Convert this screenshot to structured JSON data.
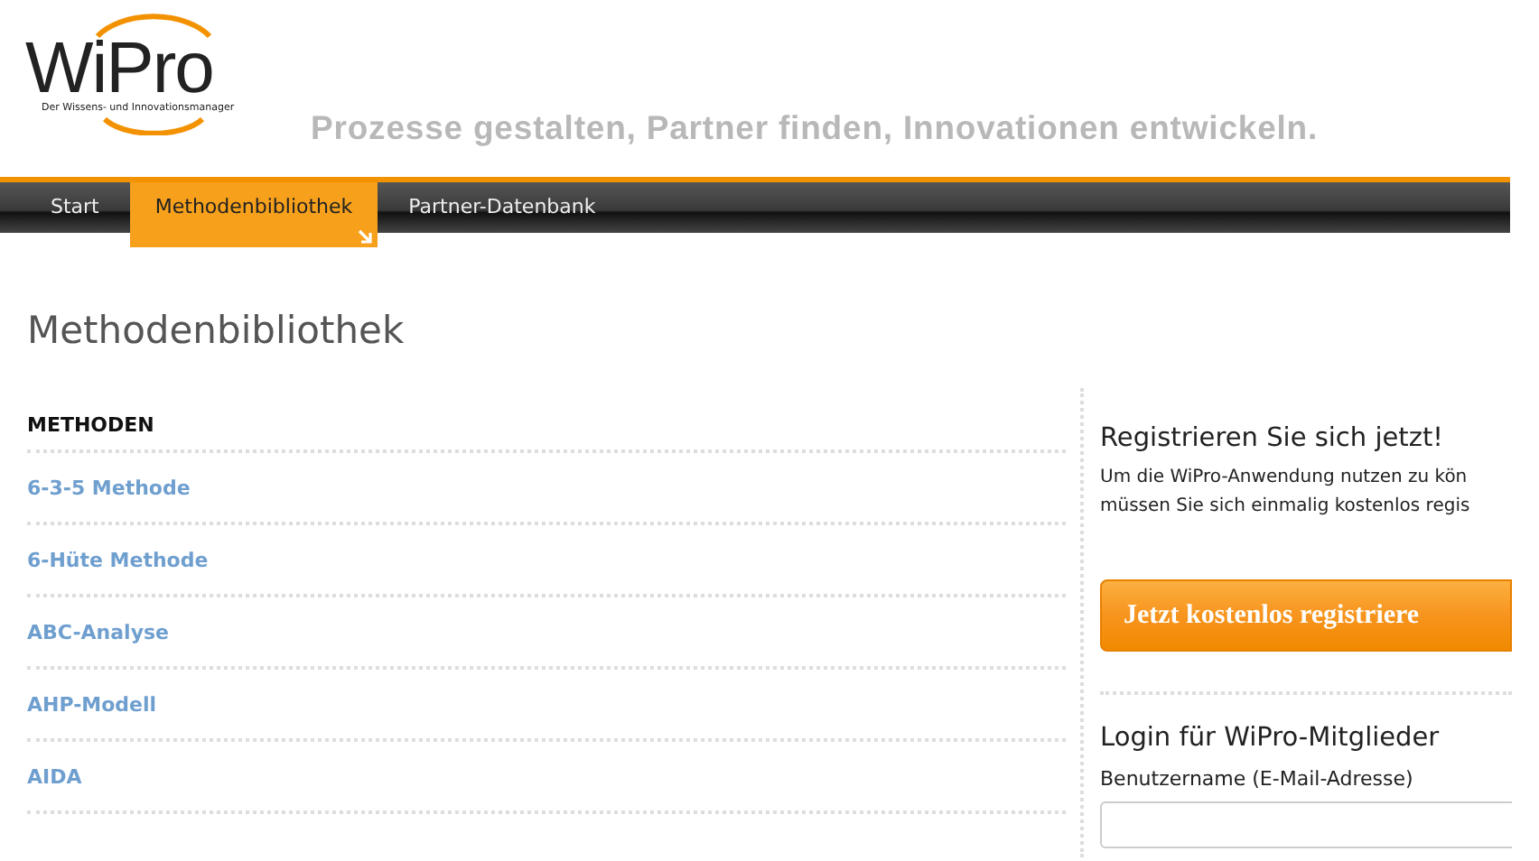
{
  "logo": {
    "name": "WiPro",
    "subtitle": "Der Wissens- und Innovationsmanager"
  },
  "tagline": "Prozesse gestalten, Partner finden, Innovationen entwickeln.",
  "nav": [
    {
      "label": "Start",
      "selected": false
    },
    {
      "label": "Methodenbibliothek",
      "selected": true
    },
    {
      "label": "Partner-Datenbank",
      "selected": false
    }
  ],
  "page_title": "Methodenbibliothek",
  "methods": {
    "heading": "METHODEN",
    "items": [
      "6-3-5 Methode",
      "6-Hüte Methode",
      "ABC-Analyse",
      "AHP-Modell",
      "AIDA"
    ]
  },
  "register": {
    "title": "Registrieren Sie sich jetzt!",
    "text_lines": [
      "Um die WiPro-Anwendung nutzen zu kön",
      "müssen Sie sich einmalig kostenlos regis"
    ],
    "button": "Jetzt kostenlos registriere"
  },
  "login": {
    "title": "Login für WiPro-Mitglieder",
    "username_label": "Benutzername (E-Mail-Adresse)"
  }
}
